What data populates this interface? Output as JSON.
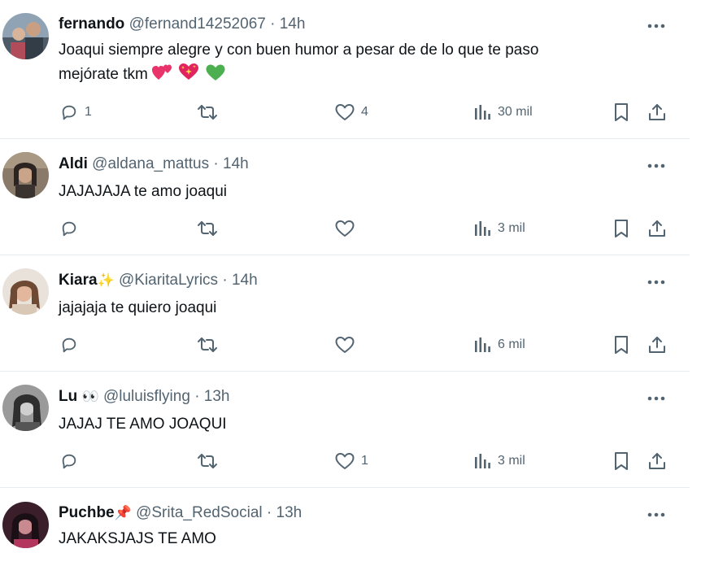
{
  "colors": {
    "text": "#0f1419",
    "secondary": "#536471",
    "divider": "#e6ecf0",
    "heart_pink": "#e8336b",
    "heart_red": "#e0245e",
    "heart_green": "#4caf50"
  },
  "tweets": [
    {
      "name": "fernando",
      "name_emoji": "",
      "handle": "@fernand14252067",
      "separator": "·",
      "time": "14h",
      "text_lines": [
        "Joaqui siempre alegre y con buen humor a pesar de de lo que te paso",
        "mejórate tkm"
      ],
      "emojis": [
        "two-hearts-icon",
        "sparkling-heart-icon",
        "green-heart-icon"
      ],
      "replies": "1",
      "retweets": "",
      "likes": "4",
      "views": "30 mil"
    },
    {
      "name": "Aldi",
      "name_emoji": "",
      "handle": "@aldana_mattus",
      "separator": "·",
      "time": "14h",
      "text_lines": [
        "JAJAJAJA te amo joaqui"
      ],
      "replies": "",
      "retweets": "",
      "likes": "",
      "views": "3 mil"
    },
    {
      "name": "Kiara",
      "name_emoji": "✨",
      "handle": "@KiaritaLyrics",
      "separator": "·",
      "time": "14h",
      "text_lines": [
        "jajajaja te quiero joaqui"
      ],
      "replies": "",
      "retweets": "",
      "likes": "",
      "views": "6 mil"
    },
    {
      "name": "Lu",
      "name_emoji": "👀",
      "handle": "@luluisflying",
      "separator": "·",
      "time": "13h",
      "text_lines": [
        "JAJAJ TE AMO JOAQUI"
      ],
      "replies": "",
      "retweets": "",
      "likes": "1",
      "views": "3 mil"
    },
    {
      "name": "Puchbe",
      "name_emoji": "📌",
      "handle": "@Srita_RedSocial",
      "separator": "·",
      "time": "13h",
      "text_lines": [
        "JAKAKSJAJS TE AMO"
      ]
    }
  ]
}
